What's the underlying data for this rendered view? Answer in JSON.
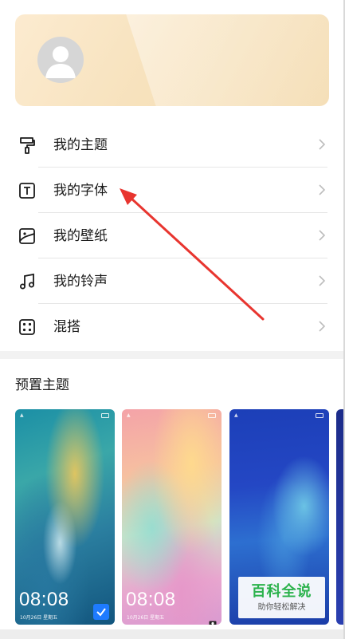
{
  "profile": {
    "avatar_icon": "user-avatar-icon"
  },
  "menu": {
    "items": [
      {
        "label": "我的主题",
        "icon": "paint-brush-icon"
      },
      {
        "label": "我的字体",
        "icon": "font-t-icon"
      },
      {
        "label": "我的壁纸",
        "icon": "image-icon"
      },
      {
        "label": "我的铃声",
        "icon": "music-note-icon"
      },
      {
        "label": "混搭",
        "icon": "dice-mix-icon"
      }
    ]
  },
  "preset": {
    "title": "预置主题",
    "themes": [
      {
        "time": "08:08",
        "date": "10月26日 星期五",
        "selected": true
      },
      {
        "time": "08:08",
        "date": "10月26日 星期五",
        "selected": false
      },
      {
        "time": "",
        "date": "",
        "selected": false
      }
    ]
  },
  "watermark": {
    "title": "百科全说",
    "subtitle": "助你轻松解决"
  },
  "colors": {
    "accent_blue": "#1e7bff",
    "annotation_red": "#e8352f",
    "watermark_green": "#2bb24c"
  }
}
